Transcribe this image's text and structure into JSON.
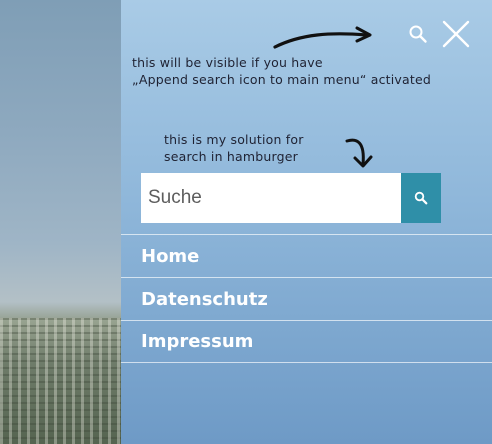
{
  "annotations": {
    "note_top_line1": "this will be visible if you have",
    "note_top_line2": "„Append search icon to main menu“ activated",
    "note_search_line1": "this is my solution for",
    "note_search_line2": "search in hamburger"
  },
  "header_icons": [
    {
      "name": "search-icon"
    },
    {
      "name": "close-icon"
    }
  ],
  "search": {
    "placeholder": "Suche",
    "value": ""
  },
  "menu": {
    "items": [
      {
        "label": "Home"
      },
      {
        "label": "Datenschutz"
      },
      {
        "label": "Impressum"
      }
    ]
  },
  "colors": {
    "search_button": "#2f8fa8",
    "menu_text": "#ffffff",
    "annotation_text": "#1f2233",
    "panel_top": "#a9cbe6",
    "panel_bottom": "#6e9ac6"
  }
}
